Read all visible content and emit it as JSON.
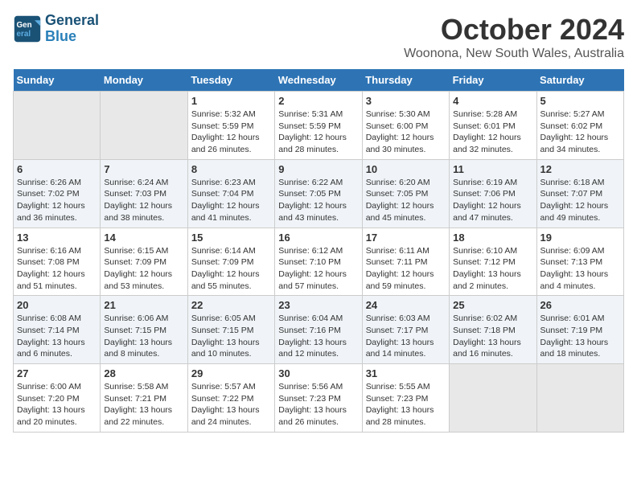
{
  "header": {
    "logo_line1": "General",
    "logo_line2": "Blue",
    "month": "October 2024",
    "location": "Woonona, New South Wales, Australia"
  },
  "weekdays": [
    "Sunday",
    "Monday",
    "Tuesday",
    "Wednesday",
    "Thursday",
    "Friday",
    "Saturday"
  ],
  "weeks": [
    [
      {
        "day": "",
        "empty": true
      },
      {
        "day": "",
        "empty": true
      },
      {
        "day": "1",
        "sunrise": "Sunrise: 5:32 AM",
        "sunset": "Sunset: 5:59 PM",
        "daylight": "Daylight: 12 hours and 26 minutes."
      },
      {
        "day": "2",
        "sunrise": "Sunrise: 5:31 AM",
        "sunset": "Sunset: 5:59 PM",
        "daylight": "Daylight: 12 hours and 28 minutes."
      },
      {
        "day": "3",
        "sunrise": "Sunrise: 5:30 AM",
        "sunset": "Sunset: 6:00 PM",
        "daylight": "Daylight: 12 hours and 30 minutes."
      },
      {
        "day": "4",
        "sunrise": "Sunrise: 5:28 AM",
        "sunset": "Sunset: 6:01 PM",
        "daylight": "Daylight: 12 hours and 32 minutes."
      },
      {
        "day": "5",
        "sunrise": "Sunrise: 5:27 AM",
        "sunset": "Sunset: 6:02 PM",
        "daylight": "Daylight: 12 hours and 34 minutes."
      }
    ],
    [
      {
        "day": "6",
        "sunrise": "Sunrise: 6:26 AM",
        "sunset": "Sunset: 7:02 PM",
        "daylight": "Daylight: 12 hours and 36 minutes."
      },
      {
        "day": "7",
        "sunrise": "Sunrise: 6:24 AM",
        "sunset": "Sunset: 7:03 PM",
        "daylight": "Daylight: 12 hours and 38 minutes."
      },
      {
        "day": "8",
        "sunrise": "Sunrise: 6:23 AM",
        "sunset": "Sunset: 7:04 PM",
        "daylight": "Daylight: 12 hours and 41 minutes."
      },
      {
        "day": "9",
        "sunrise": "Sunrise: 6:22 AM",
        "sunset": "Sunset: 7:05 PM",
        "daylight": "Daylight: 12 hours and 43 minutes."
      },
      {
        "day": "10",
        "sunrise": "Sunrise: 6:20 AM",
        "sunset": "Sunset: 7:05 PM",
        "daylight": "Daylight: 12 hours and 45 minutes."
      },
      {
        "day": "11",
        "sunrise": "Sunrise: 6:19 AM",
        "sunset": "Sunset: 7:06 PM",
        "daylight": "Daylight: 12 hours and 47 minutes."
      },
      {
        "day": "12",
        "sunrise": "Sunrise: 6:18 AM",
        "sunset": "Sunset: 7:07 PM",
        "daylight": "Daylight: 12 hours and 49 minutes."
      }
    ],
    [
      {
        "day": "13",
        "sunrise": "Sunrise: 6:16 AM",
        "sunset": "Sunset: 7:08 PM",
        "daylight": "Daylight: 12 hours and 51 minutes."
      },
      {
        "day": "14",
        "sunrise": "Sunrise: 6:15 AM",
        "sunset": "Sunset: 7:09 PM",
        "daylight": "Daylight: 12 hours and 53 minutes."
      },
      {
        "day": "15",
        "sunrise": "Sunrise: 6:14 AM",
        "sunset": "Sunset: 7:09 PM",
        "daylight": "Daylight: 12 hours and 55 minutes."
      },
      {
        "day": "16",
        "sunrise": "Sunrise: 6:12 AM",
        "sunset": "Sunset: 7:10 PM",
        "daylight": "Daylight: 12 hours and 57 minutes."
      },
      {
        "day": "17",
        "sunrise": "Sunrise: 6:11 AM",
        "sunset": "Sunset: 7:11 PM",
        "daylight": "Daylight: 12 hours and 59 minutes."
      },
      {
        "day": "18",
        "sunrise": "Sunrise: 6:10 AM",
        "sunset": "Sunset: 7:12 PM",
        "daylight": "Daylight: 13 hours and 2 minutes."
      },
      {
        "day": "19",
        "sunrise": "Sunrise: 6:09 AM",
        "sunset": "Sunset: 7:13 PM",
        "daylight": "Daylight: 13 hours and 4 minutes."
      }
    ],
    [
      {
        "day": "20",
        "sunrise": "Sunrise: 6:08 AM",
        "sunset": "Sunset: 7:14 PM",
        "daylight": "Daylight: 13 hours and 6 minutes."
      },
      {
        "day": "21",
        "sunrise": "Sunrise: 6:06 AM",
        "sunset": "Sunset: 7:15 PM",
        "daylight": "Daylight: 13 hours and 8 minutes."
      },
      {
        "day": "22",
        "sunrise": "Sunrise: 6:05 AM",
        "sunset": "Sunset: 7:15 PM",
        "daylight": "Daylight: 13 hours and 10 minutes."
      },
      {
        "day": "23",
        "sunrise": "Sunrise: 6:04 AM",
        "sunset": "Sunset: 7:16 PM",
        "daylight": "Daylight: 13 hours and 12 minutes."
      },
      {
        "day": "24",
        "sunrise": "Sunrise: 6:03 AM",
        "sunset": "Sunset: 7:17 PM",
        "daylight": "Daylight: 13 hours and 14 minutes."
      },
      {
        "day": "25",
        "sunrise": "Sunrise: 6:02 AM",
        "sunset": "Sunset: 7:18 PM",
        "daylight": "Daylight: 13 hours and 16 minutes."
      },
      {
        "day": "26",
        "sunrise": "Sunrise: 6:01 AM",
        "sunset": "Sunset: 7:19 PM",
        "daylight": "Daylight: 13 hours and 18 minutes."
      }
    ],
    [
      {
        "day": "27",
        "sunrise": "Sunrise: 6:00 AM",
        "sunset": "Sunset: 7:20 PM",
        "daylight": "Daylight: 13 hours and 20 minutes."
      },
      {
        "day": "28",
        "sunrise": "Sunrise: 5:58 AM",
        "sunset": "Sunset: 7:21 PM",
        "daylight": "Daylight: 13 hours and 22 minutes."
      },
      {
        "day": "29",
        "sunrise": "Sunrise: 5:57 AM",
        "sunset": "Sunset: 7:22 PM",
        "daylight": "Daylight: 13 hours and 24 minutes."
      },
      {
        "day": "30",
        "sunrise": "Sunrise: 5:56 AM",
        "sunset": "Sunset: 7:23 PM",
        "daylight": "Daylight: 13 hours and 26 minutes."
      },
      {
        "day": "31",
        "sunrise": "Sunrise: 5:55 AM",
        "sunset": "Sunset: 7:23 PM",
        "daylight": "Daylight: 13 hours and 28 minutes."
      },
      {
        "day": "",
        "empty": true
      },
      {
        "day": "",
        "empty": true
      }
    ]
  ]
}
